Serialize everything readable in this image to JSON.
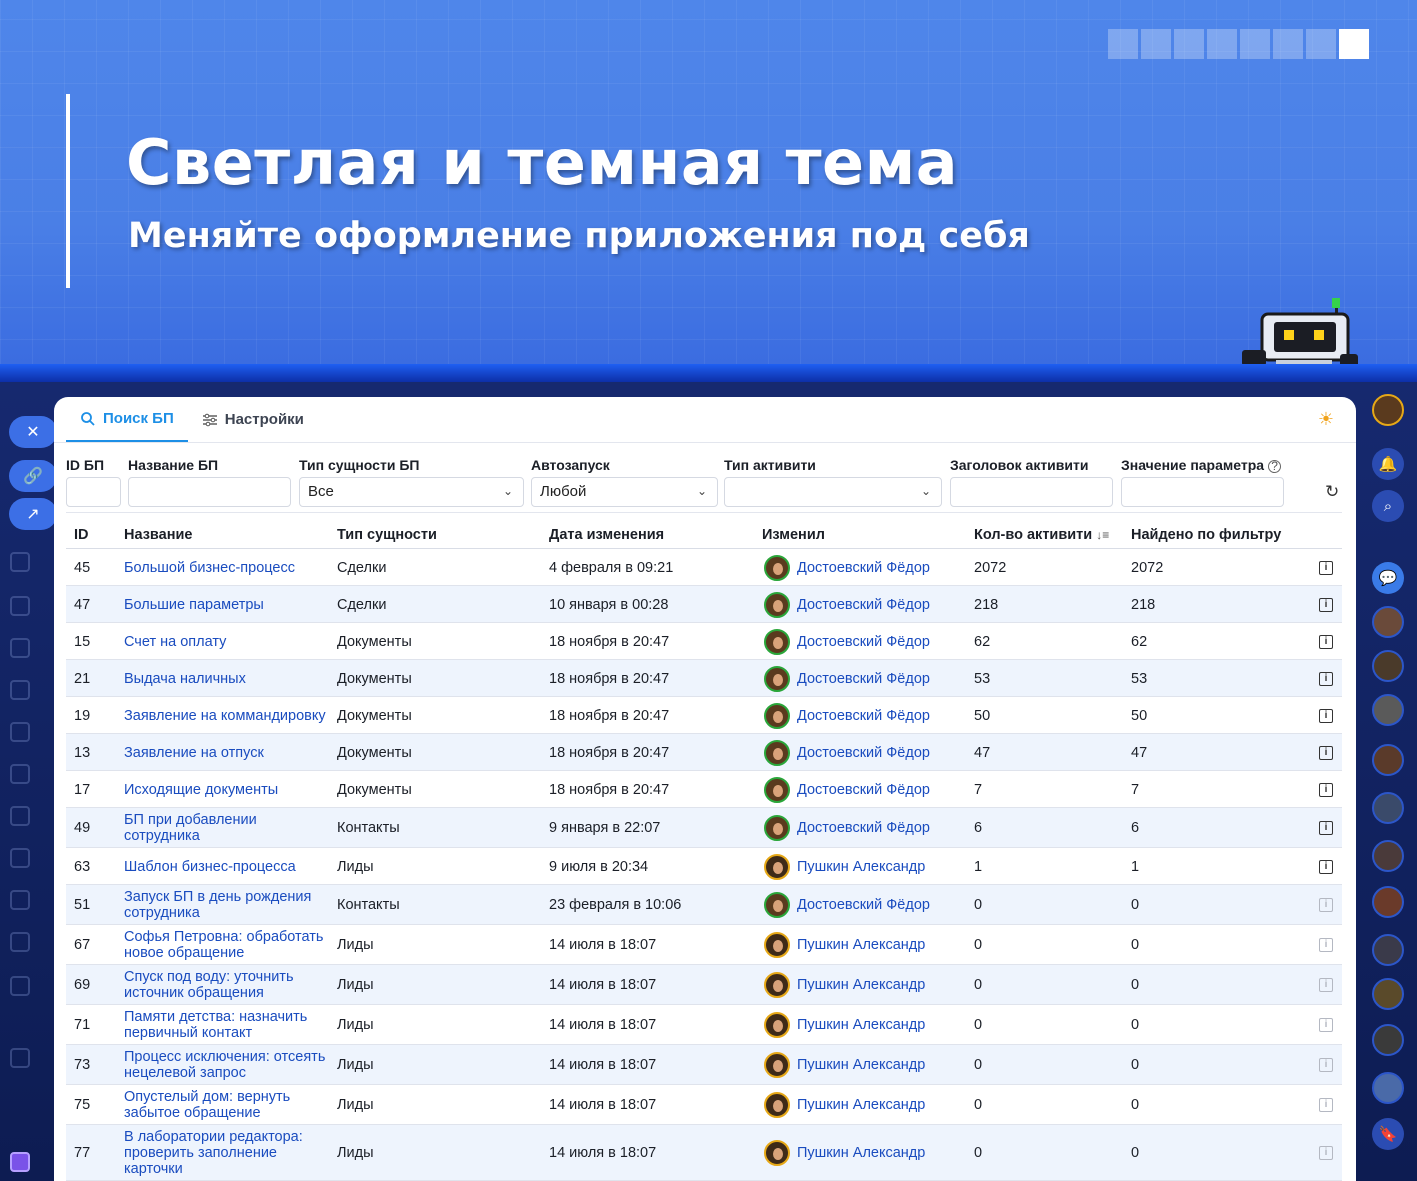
{
  "hero": {
    "title": "Светлая и темная тема",
    "subtitle": "Меняйте оформление приложения под себя"
  },
  "tabs": [
    {
      "label": "Поиск БП",
      "active": true
    },
    {
      "label": "Настройки",
      "active": false
    }
  ],
  "filters": {
    "id_label": "ID БП",
    "name_label": "Название БП",
    "entity_type_label": "Тип сущности БП",
    "entity_type_value": "Все",
    "autostart_label": "Автозапуск",
    "autostart_value": "Любой",
    "activity_type_label": "Тип активити",
    "activity_title_label": "Заголовок активити",
    "param_value_label": "Значение параметра"
  },
  "table": {
    "headers": {
      "id": "ID",
      "name": "Название",
      "entity": "Тип сущности",
      "date": "Дата изменения",
      "changed_by": "Изменил",
      "activities": "Кол-во активити",
      "found": "Найдено по фильтру"
    },
    "rows": [
      {
        "id": "45",
        "name": "Большой бизнес-процесс",
        "entity": "Сделки",
        "date": "4 февраля в 09:21",
        "user": "Достоевский Фёдор",
        "activities": "2072",
        "found": "2072"
      },
      {
        "id": "47",
        "name": "Большие параметры",
        "entity": "Сделки",
        "date": "10 января в 00:28",
        "user": "Достоевский Фёдор",
        "activities": "218",
        "found": "218"
      },
      {
        "id": "15",
        "name": "Счет на оплату",
        "entity": "Документы",
        "date": "18 ноября в 20:47",
        "user": "Достоевский Фёдор",
        "activities": "62",
        "found": "62"
      },
      {
        "id": "21",
        "name": "Выдача наличных",
        "entity": "Документы",
        "date": "18 ноября в 20:47",
        "user": "Достоевский Фёдор",
        "activities": "53",
        "found": "53"
      },
      {
        "id": "19",
        "name": "Заявление на коммандировку",
        "entity": "Документы",
        "date": "18 ноября в 20:47",
        "user": "Достоевский Фёдор",
        "activities": "50",
        "found": "50"
      },
      {
        "id": "13",
        "name": "Заявление на отпуск",
        "entity": "Документы",
        "date": "18 ноября в 20:47",
        "user": "Достоевский Фёдор",
        "activities": "47",
        "found": "47"
      },
      {
        "id": "17",
        "name": "Исходящие документы",
        "entity": "Документы",
        "date": "18 ноября в 20:47",
        "user": "Достоевский Фёдор",
        "activities": "7",
        "found": "7"
      },
      {
        "id": "49",
        "name": "БП при добавлении сотрудника",
        "entity": "Контакты",
        "date": "9 января в 22:07",
        "user": "Достоевский Фёдор",
        "activities": "6",
        "found": "6"
      },
      {
        "id": "63",
        "name": "Шаблон бизнес-процесса",
        "entity": "Лиды",
        "date": "9 июля в 20:34",
        "user": "Пушкин Александр",
        "activities": "1",
        "found": "1"
      },
      {
        "id": "51",
        "name": "Запуск БП в день рождения сотрудника",
        "entity": "Контакты",
        "date": "23 февраля в 10:06",
        "user": "Достоевский Фёдор",
        "activities": "0",
        "found": "0"
      },
      {
        "id": "67",
        "name": "Софья Петровна: обработать новое обращение",
        "entity": "Лиды",
        "date": "14 июля в 18:07",
        "user": "Пушкин Александр",
        "activities": "0",
        "found": "0"
      },
      {
        "id": "69",
        "name": "Спуск под воду: уточнить источник обращения",
        "entity": "Лиды",
        "date": "14 июля в 18:07",
        "user": "Пушкин Александр",
        "activities": "0",
        "found": "0"
      },
      {
        "id": "71",
        "name": "Памяти детства: назначить первичный контакт",
        "entity": "Лиды",
        "date": "14 июля в 18:07",
        "user": "Пушкин Александр",
        "activities": "0",
        "found": "0"
      },
      {
        "id": "73",
        "name": "Процесс исключения: отсеять нецелевой запрос",
        "entity": "Лиды",
        "date": "14 июля в 18:07",
        "user": "Пушкин Александр",
        "activities": "0",
        "found": "0"
      },
      {
        "id": "75",
        "name": "Опустелый дом: вернуть забытое обращение",
        "entity": "Лиды",
        "date": "14 июля в 18:07",
        "user": "Пушкин Александр",
        "activities": "0",
        "found": "0"
      },
      {
        "id": "77",
        "name": "В лаборатории редактора: проверить заполнение карточки",
        "entity": "Лиды",
        "date": "14 июля в 18:07",
        "user": "Пушкин Александр",
        "activities": "0",
        "found": "0"
      }
    ]
  },
  "colors": {
    "accent": "#1d8fe6",
    "link": "#1a4cbf",
    "hero": "#4a7fe6"
  }
}
